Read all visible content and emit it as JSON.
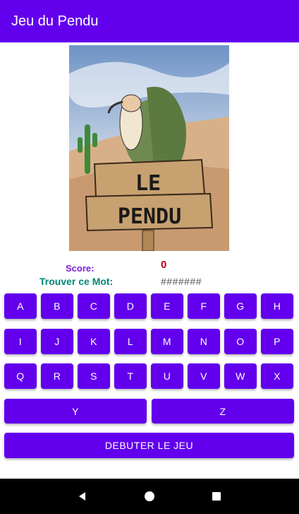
{
  "app_bar": {
    "title": "Jeu du Pendu"
  },
  "hero": {
    "sign_line1": "LE",
    "sign_line2": "PENDU"
  },
  "score": {
    "label": "Score:",
    "value": "0"
  },
  "word": {
    "label": "Trouver ce Mot:",
    "mask": "#######"
  },
  "keyboard": {
    "row1": [
      "A",
      "B",
      "C",
      "D",
      "E",
      "F",
      "G",
      "H"
    ],
    "row2": [
      "I",
      "J",
      "K",
      "L",
      "M",
      "N",
      "O",
      "P"
    ],
    "row3": [
      "Q",
      "R",
      "S",
      "T",
      "U",
      "V",
      "W",
      "X"
    ],
    "row4": [
      "Y",
      "Z"
    ]
  },
  "start_button": {
    "label": "DEBUTER LE JEU"
  },
  "nav": {
    "icons": [
      "back-icon",
      "home-icon",
      "recents-icon"
    ]
  },
  "colors": {
    "primary": "#6200ee",
    "score_label": "#7b1fd6",
    "score_value": "#b00020",
    "find_label": "#008577"
  }
}
